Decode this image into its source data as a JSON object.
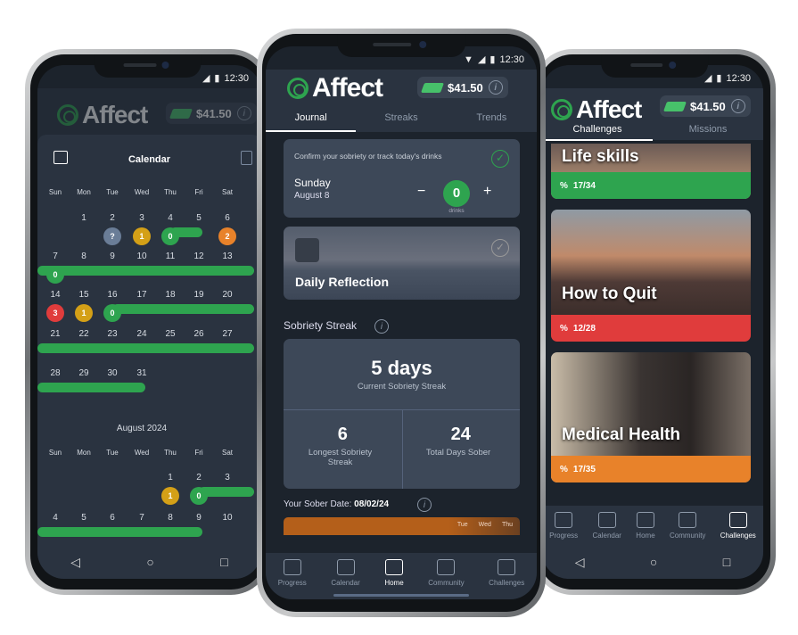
{
  "status": {
    "time": "12:30"
  },
  "app": {
    "name": "Affect",
    "balance": "$41.50",
    "info_icon": "info-icon",
    "money_icon": "money-bill-icon"
  },
  "colors": {
    "green": "#2ea44f",
    "yellow": "#d4a017",
    "orange": "#e8822a",
    "red": "#e03c3c",
    "grey": "#6a7d97",
    "bg": "#1c232c",
    "card": "#3d4858"
  },
  "journal": {
    "tabs": [
      "Journal",
      "Streaks",
      "Trends"
    ],
    "confirm": {
      "prompt": "Confirm your sobriety or track today's drinks",
      "day": "Sunday",
      "date": "August 8",
      "minus": "−",
      "plus": "+",
      "drinks": "0",
      "drinks_label": "drinks"
    },
    "reflection": {
      "title": "Daily Reflection"
    },
    "streak_title": "Sobriety Streak",
    "current": {
      "value": "5 days",
      "label": "Current Sobriety Streak"
    },
    "longest": {
      "value": "6",
      "label": "Longest Sobriety Streak"
    },
    "total": {
      "value": "24",
      "label": "Total Days Sober"
    },
    "sober_date_label": "Your Sober Date:",
    "sober_date": "08/02/24",
    "peek_days": [
      "Tue",
      "Wed",
      "Thu"
    ]
  },
  "nav": [
    {
      "label": "Progress",
      "icon": "chart-icon"
    },
    {
      "label": "Calendar",
      "icon": "calendar-icon"
    },
    {
      "label": "Home",
      "icon": "home-icon"
    },
    {
      "label": "Community",
      "icon": "community-icon"
    },
    {
      "label": "Challenges",
      "icon": "trophy-icon"
    }
  ],
  "calendar": {
    "bg_tabs": [
      "Journal",
      "Streaks",
      "Trends"
    ],
    "title": "Calendar",
    "weekdays": [
      "Sun",
      "Mon",
      "Tue",
      "Wed",
      "Thu",
      "Fri",
      "Sat"
    ],
    "months": [
      {
        "title": "",
        "weeks": [
          [
            null,
            1,
            2,
            3,
            4,
            5,
            6
          ],
          [
            7,
            8,
            9,
            10,
            11,
            12,
            13
          ],
          [
            14,
            15,
            16,
            17,
            18,
            19,
            20
          ],
          [
            21,
            22,
            23,
            24,
            25,
            26,
            27
          ],
          [
            28,
            29,
            30,
            31,
            null,
            null,
            null
          ]
        ],
        "markers": [
          {
            "day": 2,
            "value": "?",
            "color": "#6a7d97"
          },
          {
            "day": 3,
            "value": "1",
            "color": "#d4a017"
          },
          {
            "day": 4,
            "value": "0",
            "color": "#2ea44f"
          },
          {
            "day": 6,
            "value": "2",
            "color": "#e8822a"
          },
          {
            "day": 7,
            "value": "0",
            "color": "#2ea44f"
          },
          {
            "day": 14,
            "value": "3",
            "color": "#e03c3c"
          },
          {
            "day": 15,
            "value": "1",
            "color": "#d4a017"
          },
          {
            "day": 16,
            "value": "0",
            "color": "#2ea44f"
          }
        ],
        "streaks": [
          {
            "from": 4,
            "to": 5
          },
          {
            "from": 7,
            "to": 13
          },
          {
            "from": 16,
            "to": 20
          },
          {
            "from": 21,
            "to": 27
          },
          {
            "from": 28,
            "to": 31
          }
        ]
      },
      {
        "title": "August 2024",
        "weeks": [
          [
            null,
            null,
            null,
            null,
            1,
            2,
            3
          ],
          [
            4,
            5,
            6,
            7,
            8,
            9,
            10
          ]
        ],
        "markers": [
          {
            "day": 1,
            "value": "1",
            "color": "#d4a017"
          },
          {
            "day": 2,
            "value": "0",
            "color": "#2ea44f"
          }
        ],
        "streaks": [
          {
            "from": 2,
            "to": 3
          },
          {
            "from": 4,
            "to": 9
          }
        ]
      }
    ]
  },
  "challenges": {
    "tabs": [
      "Challenges",
      "Missions"
    ],
    "items": [
      {
        "title": "Life skills",
        "progress": "17/34",
        "color": "#2ea44f"
      },
      {
        "title": "How to Quit",
        "progress": "12/28",
        "color": "#e03c3c"
      },
      {
        "title": "Medical Health",
        "progress": "17/35",
        "color": "#e8822a"
      }
    ]
  },
  "android_nav": {
    "back": "◁",
    "home": "○",
    "recent": "□"
  }
}
